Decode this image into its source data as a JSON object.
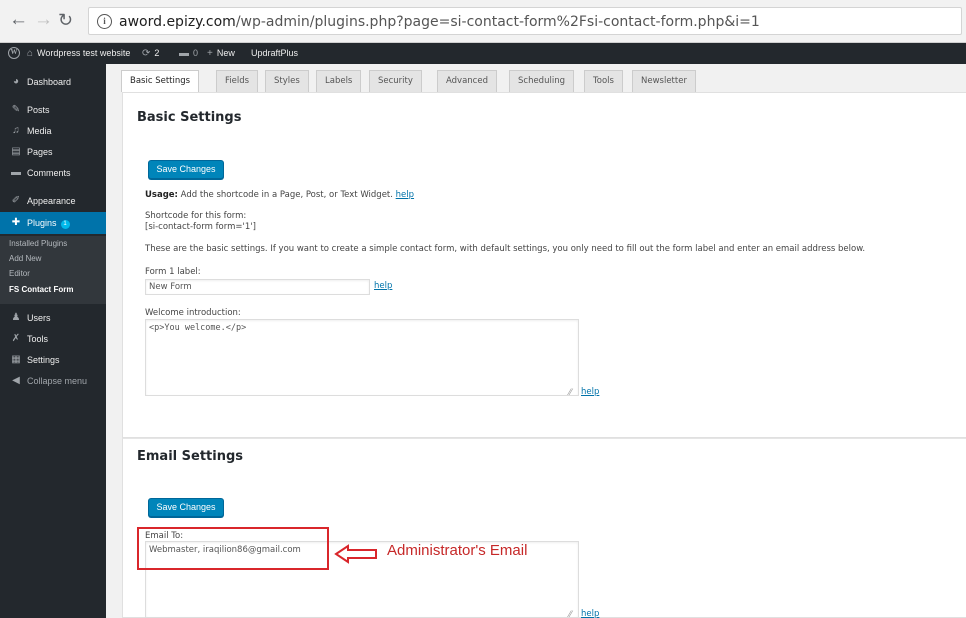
{
  "browser": {
    "url_host": "aword.epizy.com",
    "url_path": "/wp-admin/plugins.php?page=si-contact-form%2Fsi-contact-form.php&i=1",
    "icons": {
      "back": "back-arrow-icon",
      "forward": "forward-arrow-icon",
      "reload": "reload-icon",
      "info": "info-icon"
    }
  },
  "admin_bar": {
    "site_name": "Wordpress test website",
    "updates_count": "2",
    "comments_count": "0",
    "new_label": "New",
    "updraft_label": "UpdraftPlus"
  },
  "sidebar": {
    "dashboard": "Dashboard",
    "posts": "Posts",
    "media": "Media",
    "pages": "Pages",
    "comments": "Comments",
    "appearance": "Appearance",
    "plugins": "Plugins",
    "plugins_badge": "1",
    "submenu": {
      "installed": "Installed Plugins",
      "add_new": "Add New",
      "editor": "Editor",
      "fs_contact": "FS Contact Form"
    },
    "users": "Users",
    "tools": "Tools",
    "settings": "Settings",
    "collapse": "Collapse menu"
  },
  "tabs": [
    "Basic Settings",
    "Fields",
    "Styles",
    "Labels",
    "Security",
    "Advanced",
    "Scheduling",
    "Tools",
    "Newsletter"
  ],
  "basic": {
    "title": "Basic Settings",
    "save_label": "Save Changes",
    "usage_bold": "Usage:",
    "usage_text": "Add the shortcode in a Page, Post, or Text Widget.",
    "help": "help",
    "shortcode_label": "Shortcode for this form:",
    "shortcode_value": "[si-contact-form form='1']",
    "description": "These are the basic settings. If you want to create a simple contact form, with default settings, you only need to fill out the form label and enter an email address below.",
    "form_label_label": "Form 1 label:",
    "form_label_value": "New Form",
    "welcome_label": "Welcome introduction:",
    "welcome_value": "<p>You welcome.</p>"
  },
  "email": {
    "title": "Email Settings",
    "save_label": "Save Changes",
    "email_to_label": "Email To:",
    "email_to_value": "Webmaster, iraqilion86@gmail.com",
    "help": "help"
  },
  "annotation": {
    "text": "Administrator's Email",
    "color": "#d9262b"
  },
  "colors": {
    "admin_bg": "#23282d",
    "accent": "#0073aa",
    "button": "#0085ba"
  }
}
